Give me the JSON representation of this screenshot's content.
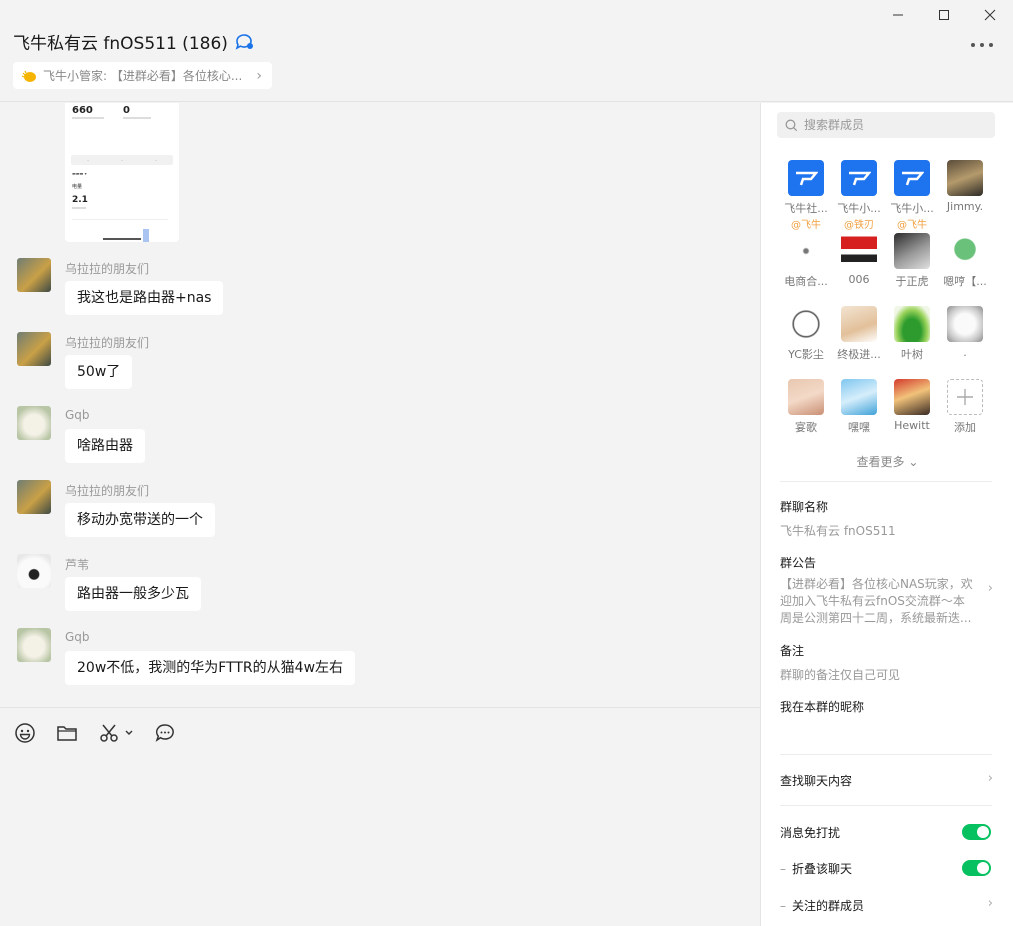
{
  "header": {
    "title": "飞牛私有云 fnOS511 (186)",
    "pinned": "飞牛小管家: 【进群必看】各位核心..."
  },
  "preview": {
    "stat_a": "660",
    "stat_b": "0",
    "big_value": "2.1",
    "label": "电量"
  },
  "messages": [
    {
      "sender": "乌拉拉的朋友们",
      "text": "我这也是路由器+nas"
    },
    {
      "sender": "乌拉拉的朋友们",
      "text": "50w了"
    },
    {
      "sender": "Gqb",
      "text": "啥路由器"
    },
    {
      "sender": "乌拉拉的朋友们",
      "text": "移动办宽带送的一个"
    },
    {
      "sender": "芦苇",
      "text": "路由器一般多少瓦"
    },
    {
      "sender": "Gqb",
      "text": "20w不低，我测的华为FTTR的从猫4w左右"
    }
  ],
  "sidebar": {
    "search_placeholder": "搜索群成员",
    "members": [
      {
        "name": "飞牛社...",
        "tag": "@飞牛"
      },
      {
        "name": "飞牛小...",
        "tag": "@铁刃"
      },
      {
        "name": "飞牛小...",
        "tag": "@飞牛"
      },
      {
        "name": "Jimmy.",
        "tag": ""
      },
      {
        "name": "电商合...",
        "tag": ""
      },
      {
        "name": "006",
        "tag": ""
      },
      {
        "name": "于正虎",
        "tag": ""
      },
      {
        "name": "嗯哼【...",
        "tag": ""
      },
      {
        "name": "YC影尘",
        "tag": ""
      },
      {
        "name": "终极进...",
        "tag": ""
      },
      {
        "name": "叶树",
        "tag": ""
      },
      {
        "name": ".",
        "tag": ""
      },
      {
        "name": "宴歌",
        "tag": ""
      },
      {
        "name": "嘿嘿",
        "tag": ""
      },
      {
        "name": "Hewitt",
        "tag": ""
      }
    ],
    "add_label": "添加",
    "see_more": "查看更多",
    "group_name_label": "群聊名称",
    "group_name_value": "飞牛私有云 fnOS511",
    "notice_label": "群公告",
    "notice_value": "【进群必看】各位核心NAS玩家，欢迎加入飞牛私有云fnOS交流群～本周是公测第四十二周，系统最新迭...",
    "remark_label": "备注",
    "remark_value": "群聊的备注仅自己可见",
    "nickname_label": "我在本群的昵称",
    "search_history": "查找聊天内容",
    "mute_label": "消息免打扰",
    "fold_label": "折叠该聊天",
    "watch_label": "关注的群成员"
  }
}
